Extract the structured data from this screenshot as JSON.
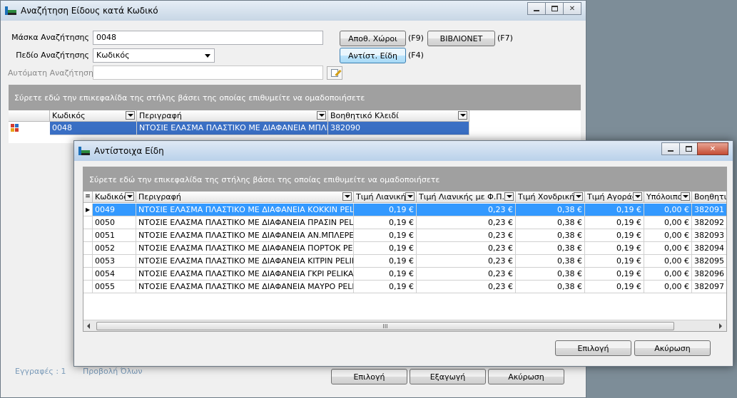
{
  "main": {
    "title": "Αναζήτηση Είδους κατά Κωδικό",
    "labels": {
      "mask": "Μάσκα Αναζήτησης",
      "field": "Πεδίο Αναζήτησης",
      "auto": "Αυτόματη Αναζήτηση"
    },
    "mask_value": "0048",
    "field_value": "Κωδικός",
    "buttons": {
      "warehouses": "Αποθ. Χώροι",
      "warehouses_key": "(F9)",
      "bibionet": "ΒΙΒΛΙΟΝΕΤ",
      "bibionet_key": "(F7)",
      "equiv": "Αντίστ. Είδη",
      "equiv_key": "(F4)",
      "select": "Επιλογή",
      "export": "Εξαγωγή",
      "cancel": "Ακύρωση"
    },
    "group_hint": "Σύρετε εδώ την επικεφαλίδα της στήλης βάσει της οποίας επιθυμείτε να ομαδοποιήσετε",
    "columns": [
      "Κωδικός",
      "Περιγραφή",
      "Βοηθητικό Κλειδί"
    ],
    "row": [
      "0048",
      "ΝΤΟΣΙΕ ΕΛΑΣΜΑ ΠΛΑΣΤΙΚΟ ΜΕ ΔΙΑΦΑΝΕΙΑ ΜΠΛΕ PELI",
      "382090"
    ],
    "status": {
      "records": "Εγγραφές : 1",
      "preview": "Προβολή Όλων"
    }
  },
  "dialog": {
    "title": "Αντίστοιχα Είδη",
    "group_hint": "Σύρετε εδώ την επικεφαλίδα της στήλης βάσει της οποίας επιθυμείτε να ομαδοποιήσετε",
    "columns": [
      "Κωδικός",
      "Περιγραφή",
      "Τιμή Λιανικής",
      "Τιμή Λιανικής με Φ.Π.Α.",
      "Τιμή Χονδρικής",
      "Τιμή Αγοράς",
      "Υπόλοιπο",
      "Βοηθητι"
    ],
    "rows": [
      [
        "0049",
        "ΝΤΟΣΙΕ ΕΛΑΣΜΑ ΠΛΑΣΤΙΚΟ ΜΕ ΔΙΑΦΑΝΕΙΑ ΚΟΚΚΙΝ PELIKAN",
        "0,19 €",
        "0,23 €",
        "0,38 €",
        "0,19 €",
        "0,00 €",
        "382091"
      ],
      [
        "0050",
        "ΝΤΟΣΙΕ ΕΛΑΣΜΑ ΠΛΑΣΤΙΚΟ ΜΕ ΔΙΑΦΑΝΕΙΑ ΠΡΑΣΙΝ PELIKAN",
        "0,19 €",
        "0,23 €",
        "0,38 €",
        "0,19 €",
        "0,00 €",
        "382092"
      ],
      [
        "0051",
        "ΝΤΟΣΙΕ ΕΛΑΣΜΑ ΠΛΑΣΤΙΚΟ ΜΕ ΔΙΑΦΑΝΕΙΑ ΑΝ.ΜΠΛΕPELIKAN",
        "0,19 €",
        "0,23 €",
        "0,38 €",
        "0,19 €",
        "0,00 €",
        "382093"
      ],
      [
        "0052",
        "ΝΤΟΣΙΕ ΕΛΑΣΜΑ ΠΛΑΣΤΙΚΟ ΜΕ ΔΙΑΦΑΝΕΙΑ ΠΟΡΤΟΚ PELIKAN",
        "0,19 €",
        "0,23 €",
        "0,38 €",
        "0,19 €",
        "0,00 €",
        "382094"
      ],
      [
        "0053",
        "ΝΤΟΣΙΕ ΕΛΑΣΜΑ ΠΛΑΣΤΙΚΟ ΜΕ ΔΙΑΦΑΝΕΙΑ ΚΙΤΡΙΝ PELIKAN",
        "0,19 €",
        "0,23 €",
        "0,38 €",
        "0,19 €",
        "0,00 €",
        "382095"
      ],
      [
        "0054",
        "ΝΤΟΣΙΕ ΕΛΑΣΜΑ ΠΛΑΣΤΙΚΟ ΜΕ ΔΙΑΦΑΝΕΙΑ ΓΚΡΙ PELIKAN",
        "0,19 €",
        "0,23 €",
        "0,38 €",
        "0,19 €",
        "0,00 €",
        "382096"
      ],
      [
        "0055",
        "ΝΤΟΣΙΕ ΕΛΑΣΜΑ ΠΛΑΣΤΙΚΟ ΜΕ ΔΙΑΦΑΝΕΙΑ ΜΑΥΡΟ PELIKAN",
        "0,19 €",
        "0,23 €",
        "0,38 €",
        "0,19 €",
        "0,00 €",
        "382097"
      ]
    ],
    "scroll_grip": "III",
    "buttons": {
      "select": "Επιλογή",
      "cancel": "Ακύρωση"
    }
  },
  "colors": {
    "selection": "#3399ff",
    "group_panel": "#a0a0a0",
    "close_button": "#c44d34"
  }
}
